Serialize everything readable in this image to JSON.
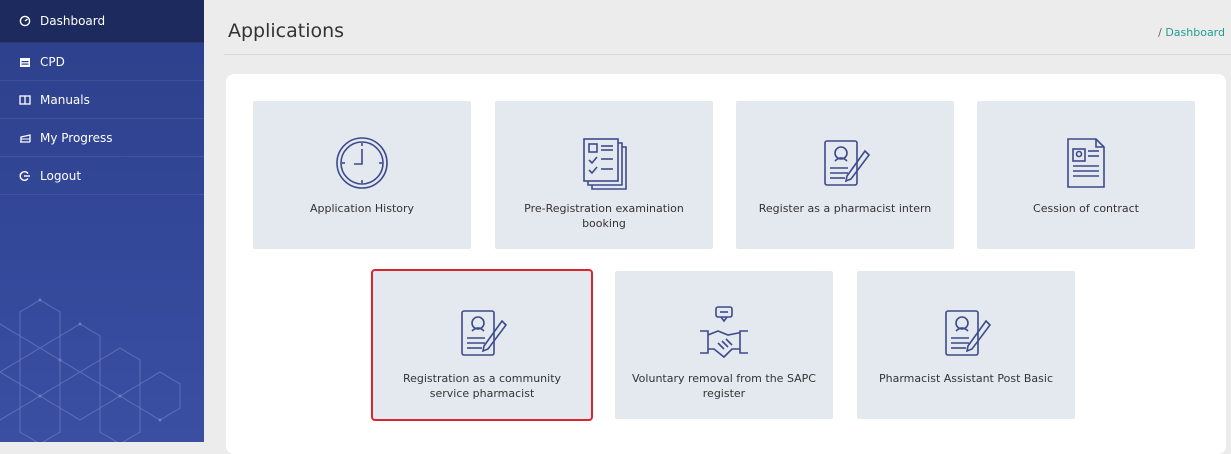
{
  "sidebar": {
    "items": [
      {
        "label": "Dashboard",
        "icon": "dashboard-icon",
        "active": true
      },
      {
        "label": "CPD",
        "icon": "calendar-icon"
      },
      {
        "label": "Manuals",
        "icon": "book-icon"
      },
      {
        "label": "My Progress",
        "icon": "chart-icon"
      },
      {
        "label": "Logout",
        "icon": "logout-icon"
      }
    ]
  },
  "header": {
    "title": "Applications",
    "breadcrumb_sep": "/",
    "breadcrumb_link": "Dashboard"
  },
  "cards": [
    {
      "label": "Application History",
      "icon": "clock-icon"
    },
    {
      "label": "Pre-Registration examination booking",
      "icon": "checklist-icon"
    },
    {
      "label": "Register as a pharmacist intern",
      "icon": "registration-form-icon"
    },
    {
      "label": "Cession of contract",
      "icon": "contract-icon"
    },
    {
      "label": "Registration as a community service pharmacist",
      "icon": "registration-form-icon"
    },
    {
      "label": "Voluntary removal from the SAPC register",
      "icon": "handshake-icon"
    },
    {
      "label": "Pharmacist Assistant Post Basic",
      "icon": "registration-form-icon"
    }
  ],
  "colors": {
    "sidebar": "#34489a",
    "accent": "#1f9e8f",
    "highlight": "#d9262e",
    "card": "#e4e9ef",
    "icon": "#3d4a8c"
  }
}
